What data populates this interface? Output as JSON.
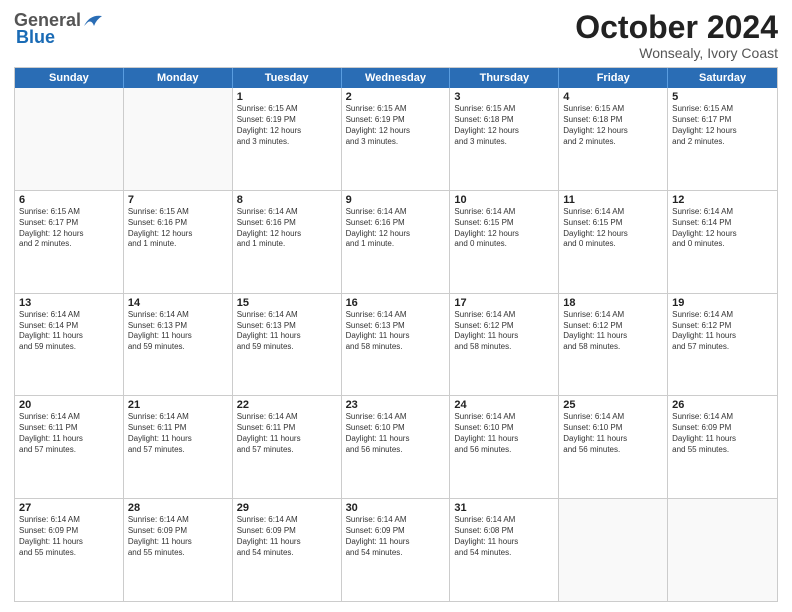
{
  "logo": {
    "general": "General",
    "blue": "Blue"
  },
  "title": "October 2024",
  "location": "Wonsealy, Ivory Coast",
  "days": [
    "Sunday",
    "Monday",
    "Tuesday",
    "Wednesday",
    "Thursday",
    "Friday",
    "Saturday"
  ],
  "weeks": [
    [
      {
        "day": "",
        "info": ""
      },
      {
        "day": "",
        "info": ""
      },
      {
        "day": "1",
        "info": "Sunrise: 6:15 AM\nSunset: 6:19 PM\nDaylight: 12 hours\nand 3 minutes."
      },
      {
        "day": "2",
        "info": "Sunrise: 6:15 AM\nSunset: 6:19 PM\nDaylight: 12 hours\nand 3 minutes."
      },
      {
        "day": "3",
        "info": "Sunrise: 6:15 AM\nSunset: 6:18 PM\nDaylight: 12 hours\nand 3 minutes."
      },
      {
        "day": "4",
        "info": "Sunrise: 6:15 AM\nSunset: 6:18 PM\nDaylight: 12 hours\nand 2 minutes."
      },
      {
        "day": "5",
        "info": "Sunrise: 6:15 AM\nSunset: 6:17 PM\nDaylight: 12 hours\nand 2 minutes."
      }
    ],
    [
      {
        "day": "6",
        "info": "Sunrise: 6:15 AM\nSunset: 6:17 PM\nDaylight: 12 hours\nand 2 minutes."
      },
      {
        "day": "7",
        "info": "Sunrise: 6:15 AM\nSunset: 6:16 PM\nDaylight: 12 hours\nand 1 minute."
      },
      {
        "day": "8",
        "info": "Sunrise: 6:14 AM\nSunset: 6:16 PM\nDaylight: 12 hours\nand 1 minute."
      },
      {
        "day": "9",
        "info": "Sunrise: 6:14 AM\nSunset: 6:16 PM\nDaylight: 12 hours\nand 1 minute."
      },
      {
        "day": "10",
        "info": "Sunrise: 6:14 AM\nSunset: 6:15 PM\nDaylight: 12 hours\nand 0 minutes."
      },
      {
        "day": "11",
        "info": "Sunrise: 6:14 AM\nSunset: 6:15 PM\nDaylight: 12 hours\nand 0 minutes."
      },
      {
        "day": "12",
        "info": "Sunrise: 6:14 AM\nSunset: 6:14 PM\nDaylight: 12 hours\nand 0 minutes."
      }
    ],
    [
      {
        "day": "13",
        "info": "Sunrise: 6:14 AM\nSunset: 6:14 PM\nDaylight: 11 hours\nand 59 minutes."
      },
      {
        "day": "14",
        "info": "Sunrise: 6:14 AM\nSunset: 6:13 PM\nDaylight: 11 hours\nand 59 minutes."
      },
      {
        "day": "15",
        "info": "Sunrise: 6:14 AM\nSunset: 6:13 PM\nDaylight: 11 hours\nand 59 minutes."
      },
      {
        "day": "16",
        "info": "Sunrise: 6:14 AM\nSunset: 6:13 PM\nDaylight: 11 hours\nand 58 minutes."
      },
      {
        "day": "17",
        "info": "Sunrise: 6:14 AM\nSunset: 6:12 PM\nDaylight: 11 hours\nand 58 minutes."
      },
      {
        "day": "18",
        "info": "Sunrise: 6:14 AM\nSunset: 6:12 PM\nDaylight: 11 hours\nand 58 minutes."
      },
      {
        "day": "19",
        "info": "Sunrise: 6:14 AM\nSunset: 6:12 PM\nDaylight: 11 hours\nand 57 minutes."
      }
    ],
    [
      {
        "day": "20",
        "info": "Sunrise: 6:14 AM\nSunset: 6:11 PM\nDaylight: 11 hours\nand 57 minutes."
      },
      {
        "day": "21",
        "info": "Sunrise: 6:14 AM\nSunset: 6:11 PM\nDaylight: 11 hours\nand 57 minutes."
      },
      {
        "day": "22",
        "info": "Sunrise: 6:14 AM\nSunset: 6:11 PM\nDaylight: 11 hours\nand 57 minutes."
      },
      {
        "day": "23",
        "info": "Sunrise: 6:14 AM\nSunset: 6:10 PM\nDaylight: 11 hours\nand 56 minutes."
      },
      {
        "day": "24",
        "info": "Sunrise: 6:14 AM\nSunset: 6:10 PM\nDaylight: 11 hours\nand 56 minutes."
      },
      {
        "day": "25",
        "info": "Sunrise: 6:14 AM\nSunset: 6:10 PM\nDaylight: 11 hours\nand 56 minutes."
      },
      {
        "day": "26",
        "info": "Sunrise: 6:14 AM\nSunset: 6:09 PM\nDaylight: 11 hours\nand 55 minutes."
      }
    ],
    [
      {
        "day": "27",
        "info": "Sunrise: 6:14 AM\nSunset: 6:09 PM\nDaylight: 11 hours\nand 55 minutes."
      },
      {
        "day": "28",
        "info": "Sunrise: 6:14 AM\nSunset: 6:09 PM\nDaylight: 11 hours\nand 55 minutes."
      },
      {
        "day": "29",
        "info": "Sunrise: 6:14 AM\nSunset: 6:09 PM\nDaylight: 11 hours\nand 54 minutes."
      },
      {
        "day": "30",
        "info": "Sunrise: 6:14 AM\nSunset: 6:09 PM\nDaylight: 11 hours\nand 54 minutes."
      },
      {
        "day": "31",
        "info": "Sunrise: 6:14 AM\nSunset: 6:08 PM\nDaylight: 11 hours\nand 54 minutes."
      },
      {
        "day": "",
        "info": ""
      },
      {
        "day": "",
        "info": ""
      }
    ]
  ]
}
